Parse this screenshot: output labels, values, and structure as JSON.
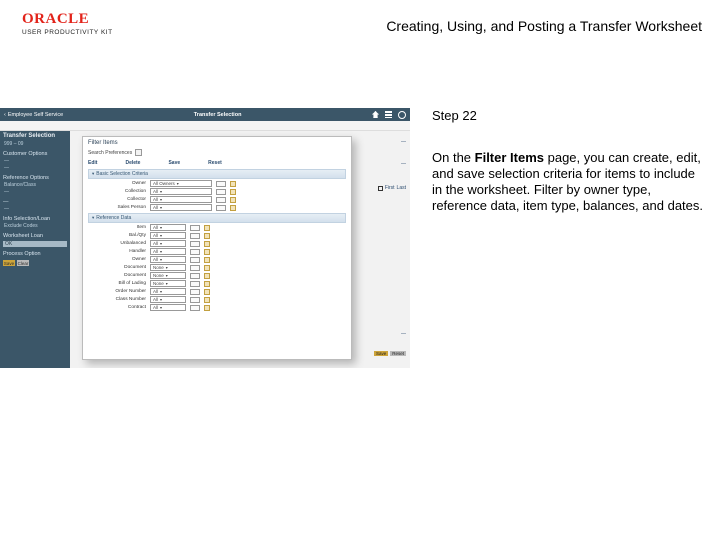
{
  "doc": {
    "title": "Creating, Using, and Posting a Transfer Worksheet",
    "product": "ORACLE",
    "subproduct": "USER PRODUCTIVITY KIT"
  },
  "instruction": {
    "step": "Step 22",
    "body_before": "On the ",
    "body_bold": "Filter Items",
    "body_after": " page, you can create, edit, and save selection criteria for items to include in the worksheet. Filter by owner type, reference data, item type, balances, and dates."
  },
  "app": {
    "title_left": "Employee Self Service",
    "title_center": "Transfer Selection",
    "subhead": "",
    "toolbar_icons": [
      "home",
      "burger",
      "globe"
    ],
    "sidebar": {
      "title": "Transfer Selection",
      "line1": "999 – 09",
      "sections": [
        {
          "label": "Customer Options",
          "items": [
            "—",
            "—"
          ]
        },
        {
          "label": "Reference Options",
          "items": [
            "Balance/Class",
            "—"
          ]
        },
        {
          "label": "—",
          "items": [
            "—"
          ]
        },
        {
          "label": "Info Selection/Loan",
          "items": [
            "Exclude Codes"
          ]
        },
        {
          "label": "Worksheet Loan",
          "items": []
        },
        {
          "label": "Process Option",
          "items": []
        }
      ],
      "chip": "OK",
      "tiny_buttons": [
        "Save",
        "Clear"
      ]
    },
    "bg_links": {
      "r1": "—",
      "r2": "—",
      "r3_first": "First",
      "r3_last": "Last",
      "r4": "—",
      "r5a": "Save",
      "r5b": "Reset"
    }
  },
  "modal": {
    "title": "Filter Items",
    "search_label": "Search Preferences",
    "toolbar": {
      "edit": "Edit",
      "delete": "Delete",
      "save": "Save",
      "reset": "Reset"
    },
    "basic_header": "Basic Selection Criteria",
    "basic_fields": [
      {
        "label": "Owner",
        "value": "All Owners"
      },
      {
        "label": "Collection",
        "value": "All"
      },
      {
        "label": "Collector",
        "value": "All"
      },
      {
        "label": "Sales Person",
        "value": "All"
      }
    ],
    "refdata_header": "Reference Data",
    "ref_fields": [
      {
        "label": "Item",
        "value": "All"
      },
      {
        "label": "Bal./Qty",
        "value": "All"
      },
      {
        "label": "Unbalanced",
        "value": "All"
      },
      {
        "label": "Handler",
        "value": "All"
      },
      {
        "label": "Owner",
        "value": "All"
      },
      {
        "label": "Document",
        "value": "None"
      },
      {
        "label": "Document",
        "value": "None"
      },
      {
        "label": "Bill of Lading",
        "value": "None"
      },
      {
        "label": "Order Number",
        "value": "All"
      },
      {
        "label": "Class Number",
        "value": "All"
      },
      {
        "label": "Contract",
        "value": "All"
      }
    ]
  }
}
